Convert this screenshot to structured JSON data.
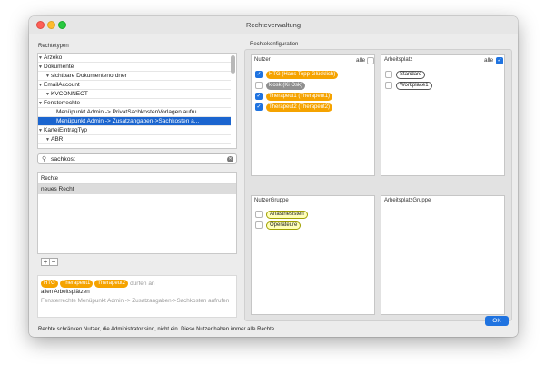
{
  "window": {
    "title": "Rechteverwaltung"
  },
  "left": {
    "types_label": "Rechtetypen",
    "tree": [
      {
        "label": "Arzeko",
        "level": 0,
        "expanded": true
      },
      {
        "label": "Dokumente",
        "level": 0,
        "expanded": true
      },
      {
        "label": "sichtbare Dokumentenordner",
        "level": 1,
        "expanded": true
      },
      {
        "label": "EmailAccount",
        "level": 0,
        "expanded": true
      },
      {
        "label": "KVCONNECT",
        "level": 1,
        "expanded": true
      },
      {
        "label": "Fensterrechte",
        "level": 0,
        "expanded": true
      },
      {
        "label": "Menüpunkt Admin -> PrivatSachkostenVorlagen aufru...",
        "level": 1,
        "expanded": false
      },
      {
        "label": "Menüpunkt Admin -> Zusatzangaben->Sachkosten a...",
        "level": 1,
        "expanded": false,
        "selected": true
      },
      {
        "label": "KarteiEintragTyp",
        "level": 0,
        "expanded": true
      },
      {
        "label": "ABR",
        "level": 1,
        "expanded": true
      }
    ],
    "search": {
      "value": "sachkost"
    },
    "rechte_label": "Rechte",
    "rechte_rows": [
      "neues Recht"
    ],
    "add_label": "+",
    "remove_label": "−",
    "info": {
      "pills": [
        "HTG",
        "Therapeut1",
        "Therapeut2"
      ],
      "duerfen": "dürfen an",
      "alle_arbeitsplaetze": "allen Arbeitsplätzen",
      "description": "Fensterrechte Menüpunkt Admin -> Zusatzangaben->Sachkosten aufrufen"
    }
  },
  "right": {
    "config_label": "Rechtekonfiguration",
    "nutzer": {
      "header": "Nutzer",
      "alle_label": "alle",
      "alle_checked": false,
      "items": [
        {
          "label": "HTG (Hans Topp-Glücklich)",
          "checked": true,
          "style": "orange"
        },
        {
          "label": "kiosk (Ki Osk)",
          "checked": false,
          "style": "gray"
        },
        {
          "label": "Therapeut1 (Therapeut1)",
          "checked": true,
          "style": "orange"
        },
        {
          "label": "Therapeut2 (Therapeut2)",
          "checked": true,
          "style": "orange"
        }
      ]
    },
    "arbeitsplatz": {
      "header": "Arbeitsplatz",
      "alle_label": "alle",
      "alle_checked": true,
      "items": [
        {
          "label": "Standard",
          "checked": false,
          "style": "outline"
        },
        {
          "label": "Workplace1",
          "checked": false,
          "style": "outline"
        }
      ]
    },
    "nutzergruppe": {
      "header": "NutzerGruppe",
      "items": [
        {
          "label": "Anästhesisten",
          "checked": false,
          "style": "yellow"
        },
        {
          "label": "Operateure",
          "checked": false,
          "style": "yellow"
        }
      ]
    },
    "arbeitsplatzgruppe": {
      "header": "ArbeitsplatzGruppe"
    }
  },
  "ok_label": "OK",
  "footer_text": "Rechte schränken Nutzer, die Administrator sind, nicht ein. Diese Nutzer haben immer alle Rechte.",
  "colors": {
    "accent": "#1f73e0",
    "selection": "#1b65cf",
    "user_pill": "#f5a300",
    "group_pill": "#ffffb8"
  }
}
